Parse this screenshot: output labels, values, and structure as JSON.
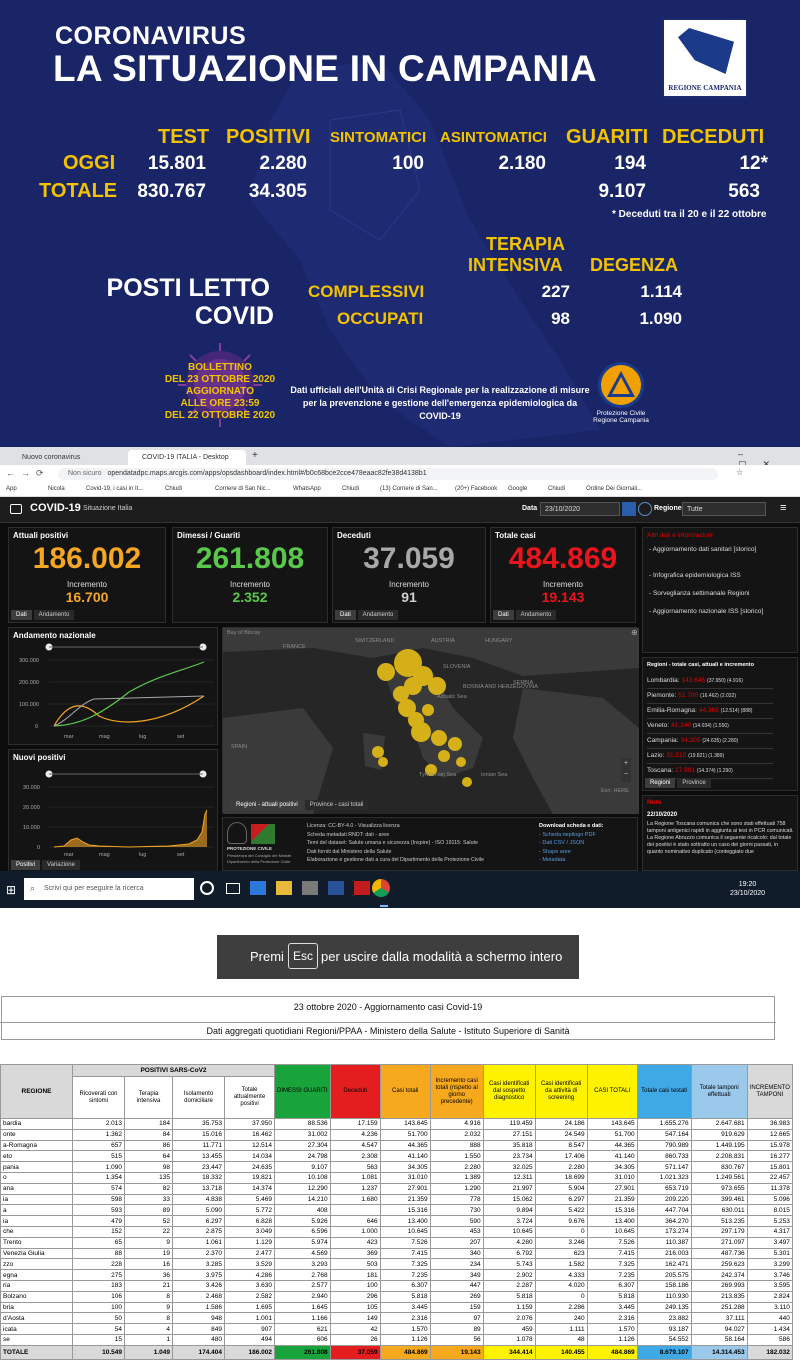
{
  "infographic": {
    "title_line1": "CORONAVIRUS",
    "title_line2": "LA SITUAZIONE IN CAMPANIA",
    "logo_text": "REGIONE CAMPANIA",
    "headers": {
      "test": "TEST",
      "positivi": "POSITIVI",
      "sintomatici": "SINTOMATICI",
      "asintomatici": "ASINTOMATICI",
      "guariti": "GUARITI",
      "deceduti": "DECEDUTI"
    },
    "row_oggi": {
      "label": "OGGI",
      "test": "15.801",
      "positivi": "2.280",
      "sintomatici": "100",
      "asintomatici": "2.180",
      "guariti": "194",
      "deceduti": "12*"
    },
    "row_totale": {
      "label": "TOTALE",
      "test": "830.767",
      "positivi": "34.305",
      "guariti": "9.107",
      "deceduti": "563"
    },
    "footnote": "* Deceduti tra il 20 e il 22 ottobre",
    "beds": {
      "title1": "POSTI LETTO",
      "title2": "COVID",
      "col1_line1": "TERAPIA",
      "col1_line2": "INTENSIVA",
      "col2": "DEGENZA",
      "row1_label": "COMPLESSIVI",
      "row1_ti": "227",
      "row1_deg": "1.114",
      "row2_label": "OCCUPATI",
      "row2_ti": "98",
      "row2_deg": "1.090"
    },
    "bulletin": [
      "BOLLETTINO",
      "DEL 23 OTTOBRE 2020",
      "AGGIORNATO",
      "ALLE ORE 23:59",
      "DEL 22 OTTOBRE 2020"
    ],
    "official_text": [
      "Dati ufficiali dell'Unità di Crisi Regionale per la realizzazione di misure",
      "per la prevenzione e gestione dell'emergenza epidemiologica da COVID-19"
    ],
    "protezione_civile": [
      "Protezione Civile",
      "Regione Campania"
    ]
  },
  "browser": {
    "tabs": [
      "Nuovo coronavirus",
      "COVID-19 ITALIA - Desktop"
    ],
    "url_prefix": "Non sicuro",
    "url": "opendatadpc.maps.arcgis.com/apps/opsdashboard/index.html#/b0c68bce2cce478eaac82fe38d4138b1",
    "bookmarks": [
      "App",
      "Nicola",
      "Covid-19, i casi in It...",
      "Chiudi",
      "Corriere di San Nic...",
      "WhatsApp",
      "Chiudi",
      "(13) Corriere di San...",
      "(20+) Facebook",
      "Google",
      "Chiudi",
      "Ordine Dei Giornali..."
    ],
    "dashboard": {
      "title": "COVID-19",
      "subtitle": "Situazione Italia",
      "data_label": "Data",
      "data_value": "23/10/2020",
      "regione_label": "Regione",
      "regione_value": "Tutte",
      "cards": [
        {
          "title": "Attuali positivi",
          "value": "186.002",
          "inc_label": "Incremento",
          "inc": "16.700",
          "color": "#f5a623",
          "tabs": [
            "Dati",
            "Andamento"
          ]
        },
        {
          "title": "Dimessi / Guariti",
          "value": "261.808",
          "inc_label": "Incremento",
          "inc": "2.352",
          "color": "#5ac84a",
          "tabs": []
        },
        {
          "title": "Deceduti",
          "value": "37.059",
          "inc_label": "Incremento",
          "inc": "91",
          "color": "#a8a8a8",
          "tabs": [
            "Dati",
            "Andamento"
          ]
        },
        {
          "title": "Totale casi",
          "value": "484.869",
          "inc_label": "Incremento",
          "inc": "19.143",
          "color": "#e8161c",
          "tabs": [
            "Dati",
            "Andamento"
          ]
        }
      ],
      "chart1": {
        "title": "Andamento nazionale",
        "yticks": [
          "300.000",
          "200.000",
          "100.000",
          "0"
        ],
        "xticks": [
          "mar",
          "mag",
          "lug",
          "set"
        ]
      },
      "chart2": {
        "title": "Nuovi positivi",
        "yticks": [
          "30.000",
          "20.000",
          "10.000",
          "0"
        ],
        "xticks": [
          "mar",
          "mag",
          "lug",
          "set"
        ],
        "tabs": [
          "Positivi",
          "Variazione"
        ]
      },
      "map": {
        "labels": [
          "FRANCE",
          "SWITZERLAND",
          "AUSTRIA",
          "HUNGARY",
          "SLOVENIA",
          "BOSNIA AND HERZEGOVINA",
          "SERBIA",
          "SPAIN",
          "Bay of Biscay",
          "Tyrrhenian Sea",
          "Ionian Sea",
          "Adriatic Sea"
        ],
        "attribution": "Esri, HERE",
        "tabs": [
          "Regioni - attuali positivi",
          "Province - casi totali"
        ]
      },
      "side_title": "Altri dati e informazioni",
      "side_links": [
        "- Aggiornamento dati sanitari [storico]",
        "- Infografica epidemiologica ISS",
        "- Sorveglianza settimanale Regioni",
        "- Aggiornamento nazionale ISS [storico]"
      ],
      "regions_title": "Regioni - totale casi, attuali e incremento",
      "regions": [
        {
          "name": "Lombardia:",
          "tot": "143.645",
          "rest": "(37.950) (4.916)"
        },
        {
          "name": "Piemonte:",
          "tot": "51.700",
          "rest": "(16.462) (2.032)"
        },
        {
          "name": "Emilia-Romagna:",
          "tot": "44.365",
          "rest": "(12.514) (888)"
        },
        {
          "name": "Veneto:",
          "tot": "41.140",
          "rest": "(14.034) (1.550)"
        },
        {
          "name": "Campania:",
          "tot": "34.305",
          "rest": "(24.635) (2.280)"
        },
        {
          "name": "Lazio:",
          "tot": "31.010",
          "rest": "(19.821) (1.389)"
        },
        {
          "name": "Toscana:",
          "tot": "27.901",
          "rest": "(14.374) (1.290)"
        }
      ],
      "regions_tabs": [
        "Regioni",
        "Province"
      ],
      "note_title": "Note",
      "note_date": "22/10/2020",
      "note_text": "La Regione Toscana comunica che sono stati effettuati 758 tamponi antigenici rapidi in aggiunta ai test in PCR comunicati. La Regione Abruzzo comunica il seguente ricalcolo: dal totale dei positivi è stato sottratto un caso dei giorni passati, in quanto nominativo duplicato (conteggiato due",
      "footer_licence": [
        "Licenza: CC-BY-4.0 - Visualizza licenza",
        "Scheda metadati RNDT: dati - aree",
        "Temi del dataset: Salute umana e sicurezza (Inspire) - ISO 19115: Salute",
        "Dati forniti dal Ministero della Salute",
        "Elaborazione e gestione dati a cura del Dipartimento della Protezione Civile"
      ],
      "footer_download": [
        "Download scheda e dati:",
        "- Scheda riepilogo PDF",
        "- Dati CSV / JSON",
        "- Shape aree",
        "- Metadata"
      ],
      "footer_logo": [
        "PROTEZIONE CIVILE",
        "Presidenza del Consiglio dei Ministri",
        "Dipartimento della Protezione Civile"
      ]
    },
    "taskbar": {
      "search": "Scrivi qui per eseguire la ricerca",
      "time": "19:20",
      "date": "23/10/2020"
    }
  },
  "esc_banner": {
    "before": "Premi",
    "key": "Esc",
    "after": "per uscire dalla modalità a schermo intero"
  },
  "table": {
    "title": "23 ottobre 2020 - Aggiornamento casi Covid-19",
    "subtitle": "Dati aggregati quotidiani Regioni/PPAA - Ministero della Salute - Istituto Superiore di Sanità",
    "group_header": "POSITIVI SARS-CoV2",
    "headers": [
      "REGIONE",
      "Ricoverati con sintomi",
      "Terapia intensiva",
      "Isolamento domiciliare",
      "Totale attualmente positivi",
      "DIMESSI GUARITI",
      "Deceduti",
      "Casi totali",
      "Incremento casi totali (rispetto al giorno precedente)",
      "Casi identificati dal sospetto diagnostico",
      "Casi identificati da attività di screening",
      "CASI TOTALI",
      "Totale casi testati",
      "Totale tamponi effettuati",
      "INCREMENTO TAMPONI"
    ],
    "rows": [
      [
        "bardia",
        "2.013",
        "184",
        "35.753",
        "37.950",
        "88.536",
        "17.159",
        "143.645",
        "4.916",
        "119.459",
        "24.186",
        "143.645",
        "1.655.276",
        "2.647.681",
        "36.983"
      ],
      [
        "onte",
        "1.362",
        "84",
        "15.016",
        "16.462",
        "31.002",
        "4.236",
        "51.700",
        "2.032",
        "27.151",
        "24.549",
        "51.700",
        "547.164",
        "919.629",
        "12.665"
      ],
      [
        "a-Romagna",
        "657",
        "86",
        "11.771",
        "12.514",
        "27.304",
        "4.547",
        "44.365",
        "888",
        "35.818",
        "8.547",
        "44.365",
        "790.989",
        "1.449.195",
        "15.978"
      ],
      [
        "eto",
        "515",
        "64",
        "13.455",
        "14.034",
        "24.798",
        "2.308",
        "41.140",
        "1.550",
        "23.734",
        "17.406",
        "41.140",
        "860.733",
        "2.208.831",
        "16.277"
      ],
      [
        "pania",
        "1.090",
        "98",
        "23.447",
        "24.635",
        "9.107",
        "563",
        "34.305",
        "2.280",
        "32.025",
        "2.280",
        "34.305",
        "571.147",
        "830.767",
        "15.801"
      ],
      [
        "o",
        "1.354",
        "135",
        "18.332",
        "19.821",
        "10.108",
        "1.081",
        "31.010",
        "1.389",
        "12.311",
        "18.699",
        "31.010",
        "1.021.323",
        "1.249.561",
        "22.457"
      ],
      [
        "ana",
        "574",
        "82",
        "13.718",
        "14.374",
        "12.290",
        "1.237",
        "27.901",
        "1.290",
        "21.997",
        "5.904",
        "27.901",
        "653.719",
        "973.655",
        "11.378"
      ],
      [
        "ia",
        "598",
        "33",
        "4.838",
        "5.469",
        "14.210",
        "1.680",
        "21.359",
        "778",
        "15.062",
        "6.297",
        "21.359",
        "209.220",
        "399.461",
        "5.096"
      ],
      [
        "a",
        "593",
        "89",
        "5.090",
        "5.772",
        "408",
        "",
        "15.316",
        "730",
        "9.894",
        "5.422",
        "15.316",
        "447.704",
        "630.011",
        "8.015"
      ],
      [
        "ia",
        "479",
        "52",
        "6.297",
        "6.828",
        "5.926",
        "646",
        "13.400",
        "590",
        "3.724",
        "9.676",
        "13.400",
        "364.270",
        "513.235",
        "5.253"
      ],
      [
        "che",
        "152",
        "22",
        "2.875",
        "3.049",
        "6.596",
        "1.000",
        "10.645",
        "453",
        "10.645",
        "0",
        "10.645",
        "173.274",
        "297.179",
        "4.317"
      ],
      [
        "Trento",
        "65",
        "9",
        "1.061",
        "1.129",
        "5.974",
        "423",
        "7.526",
        "207",
        "4.280",
        "3.246",
        "7.526",
        "110.387",
        "271.097",
        "3.497"
      ],
      [
        "Venezia Giulia",
        "88",
        "19",
        "2.370",
        "2.477",
        "4.569",
        "369",
        "7.415",
        "340",
        "6.792",
        "623",
        "7.415",
        "216.003",
        "487.736",
        "5.301"
      ],
      [
        "zzo",
        "228",
        "16",
        "3.285",
        "3.529",
        "3.293",
        "503",
        "7.325",
        "234",
        "5.743",
        "1.582",
        "7.325",
        "162.471",
        "259.623",
        "3.299"
      ],
      [
        "egna",
        "275",
        "36",
        "3.975",
        "4.286",
        "2.768",
        "181",
        "7.235",
        "349",
        "2.902",
        "4.333",
        "7.235",
        "205.575",
        "242.374",
        "3.746"
      ],
      [
        "ria",
        "183",
        "21",
        "3.426",
        "3.630",
        "2.577",
        "100",
        "6.307",
        "447",
        "2.287",
        "4.020",
        "6.307",
        "158.186",
        "269.993",
        "3.595"
      ],
      [
        "Bolzano",
        "106",
        "8",
        "2.468",
        "2.582",
        "2.940",
        "296",
        "5.818",
        "269",
        "5.818",
        "0",
        "5.818",
        "110.930",
        "213.835",
        "2.824"
      ],
      [
        "bria",
        "100",
        "9",
        "1.586",
        "1.695",
        "1.645",
        "105",
        "3.445",
        "159",
        "1.159",
        "2.286",
        "3.445",
        "249.135",
        "251.288",
        "3.110"
      ],
      [
        "d'Aosta",
        "50",
        "8",
        "948",
        "1.001",
        "1.166",
        "149",
        "2.316",
        "97",
        "2.076",
        "240",
        "2.316",
        "23.882",
        "37.111",
        "440"
      ],
      [
        "icata",
        "54",
        "4",
        "849",
        "907",
        "621",
        "42",
        "1.570",
        "89",
        "459",
        "1.111",
        "1.570",
        "93.187",
        "94.027",
        "1.434"
      ],
      [
        "se",
        "15",
        "1",
        "480",
        "494",
        "606",
        "26",
        "1.126",
        "56",
        "1.078",
        "48",
        "1.126",
        "54.552",
        "58.164",
        "586"
      ]
    ],
    "total": [
      "TOTALE",
      "10.549",
      "1.049",
      "174.404",
      "186.002",
      "261.808",
      "37.059",
      "484.869",
      "19.143",
      "344.414",
      "140.455",
      "484.869",
      "8.679.107",
      "14.314.453",
      "182.032"
    ]
  },
  "colors": {
    "infographic_bg": "#192566",
    "yellow": "#f3c200",
    "guariti": "#19a33b",
    "deceduti": "#e41e1e",
    "casi_totali": "#f7a91e",
    "yellow_cells": "#fff200",
    "blue": "#3fa9e6"
  }
}
